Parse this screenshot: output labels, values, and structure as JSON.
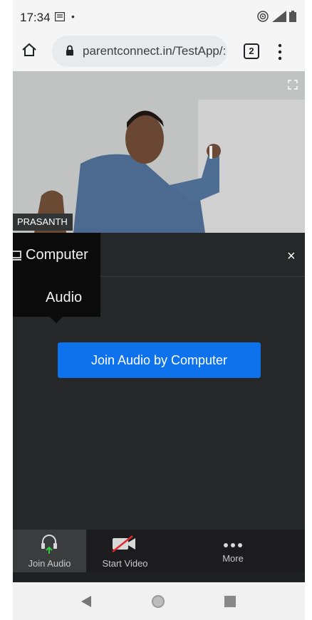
{
  "status_bar": {
    "time": "17:34"
  },
  "browser": {
    "url": "parentconnect.in/TestApp/:",
    "tab_count": "2"
  },
  "video": {
    "participant_name": "PRASANTH"
  },
  "audio_panel": {
    "tab_line1": "Computer",
    "tab_line2": "Audio",
    "close": "×",
    "join_button": "Join Audio by Computer"
  },
  "toolbar": {
    "join_audio": "Join Audio",
    "start_video": "Start Video",
    "more": "More"
  },
  "colors": {
    "accent": "#0e72ed",
    "panel": "#262729",
    "toolbar": "#1c1c1e"
  }
}
